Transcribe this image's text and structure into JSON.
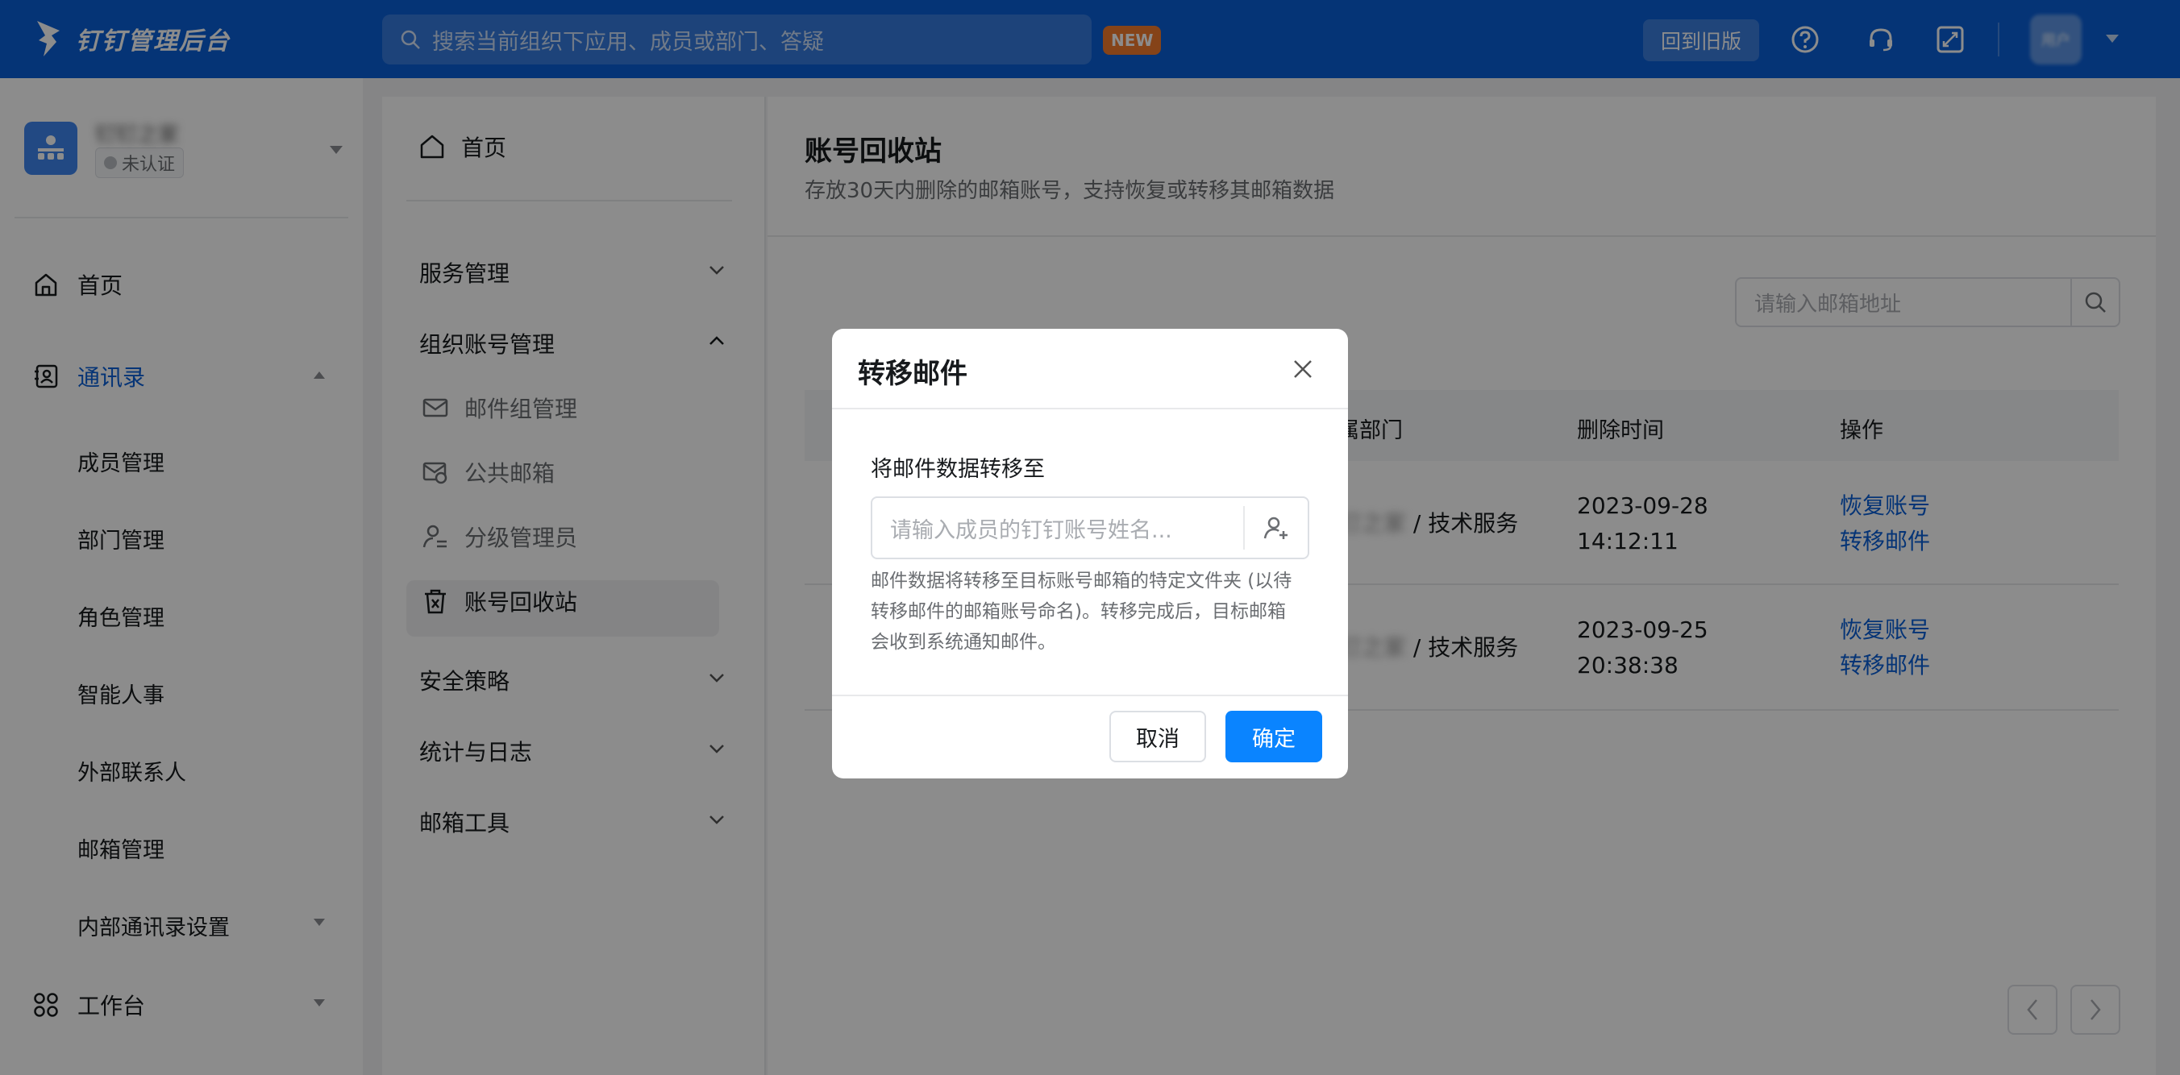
{
  "topbar": {
    "app_name": "钉钉管理后台",
    "search_placeholder": "搜索当前组织下应用、成员或部门、答疑",
    "new_badge": "NEW",
    "old_version_button": "回到旧版",
    "avatar_text": "用户"
  },
  "org": {
    "name": "钉钉之家",
    "status": "未认证"
  },
  "sidebar": {
    "home": "首页",
    "contacts": "通讯录",
    "sub_items": [
      "成员管理",
      "部门管理",
      "角色管理",
      "智能人事",
      "外部联系人",
      "邮箱管理",
      "内部通讯录设置"
    ],
    "workbench": "工作台"
  },
  "midmenu": {
    "home": "首页",
    "service_mgmt": "服务管理",
    "org_account_mgmt": "组织账号管理",
    "mail_group_mgmt": "邮件组管理",
    "public_mailbox": "公共邮箱",
    "tiered_admin": "分级管理员",
    "account_recycle": "账号回收站",
    "security_policy": "安全策略",
    "stats_logs": "统计与日志",
    "mail_tools": "邮箱工具"
  },
  "content": {
    "title": "账号回收站",
    "subtitle": "存放30天内删除的邮箱账号，支持恢复或转移其邮箱数据",
    "search_placeholder": "请输入邮箱地址",
    "columns": {
      "dept": "所属部门",
      "deleted_time": "删除时间",
      "action": "操作"
    },
    "rows": [
      {
        "dept_prefix": "钉钉之家",
        "dept_suffix": "/ 技术服务",
        "date": "2023-09-28",
        "time": "14:12:11",
        "restore": "恢复账号",
        "transfer": "转移邮件"
      },
      {
        "dept_prefix": "钉钉之家",
        "dept_suffix": "/ 技术服务",
        "date": "2023-09-25",
        "time": "20:38:38",
        "restore": "恢复账号",
        "transfer": "转移邮件"
      }
    ]
  },
  "modal": {
    "title": "转移邮件",
    "label": "将邮件数据转移至",
    "input_placeholder": "请输入成员的钉钉账号姓名...",
    "help_line1": "邮件数据将转移至目标账号邮箱的特定文件夹 (以待",
    "help_line2": "转移邮件的邮箱账号命名)。转移完成后，目标邮箱",
    "help_line3": "会收到系统通知邮件。",
    "cancel": "取消",
    "ok": "确定"
  },
  "colors": {
    "brand": "#0a5fd8",
    "primary_button": "#0a84ff",
    "badge": "#f27a2c"
  }
}
